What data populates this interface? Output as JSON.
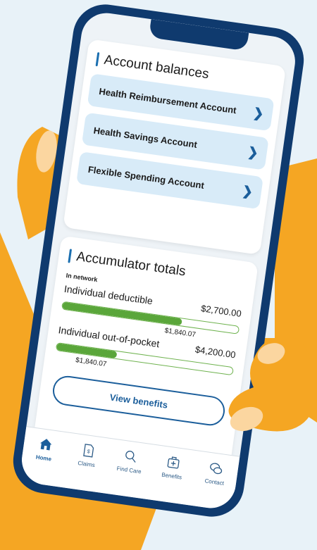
{
  "accounts": {
    "title": "Account balances",
    "items": [
      {
        "label": "Health Reimbursement Account"
      },
      {
        "label": "Health Savings Account"
      },
      {
        "label": "Flexible Spending Account"
      }
    ]
  },
  "accumulators": {
    "title": "Accumulator totals",
    "network": "In network",
    "rows": [
      {
        "label": "Individual deductible",
        "total": "$2,700.00",
        "used": "$1,840.07",
        "fraction": 0.68
      },
      {
        "label": "Individual out-of-pocket",
        "total": "$4,200.00",
        "used": "$1,840.07",
        "fraction": 0.34
      }
    ],
    "button": "View benefits"
  },
  "tabs": [
    {
      "label": "Home",
      "icon": "home-icon",
      "active": true
    },
    {
      "label": "Claims",
      "icon": "claims-icon"
    },
    {
      "label": "Find Care",
      "icon": "search-icon"
    },
    {
      "label": "Benefits",
      "icon": "benefits-icon"
    },
    {
      "label": "Contact",
      "icon": "chat-icon"
    }
  ],
  "colors": {
    "background": "#e8f2f8",
    "phone": "#0f3a6e",
    "accent": "#1b5e9b",
    "hand": "#f5a623",
    "progress": "#5aa63a"
  }
}
